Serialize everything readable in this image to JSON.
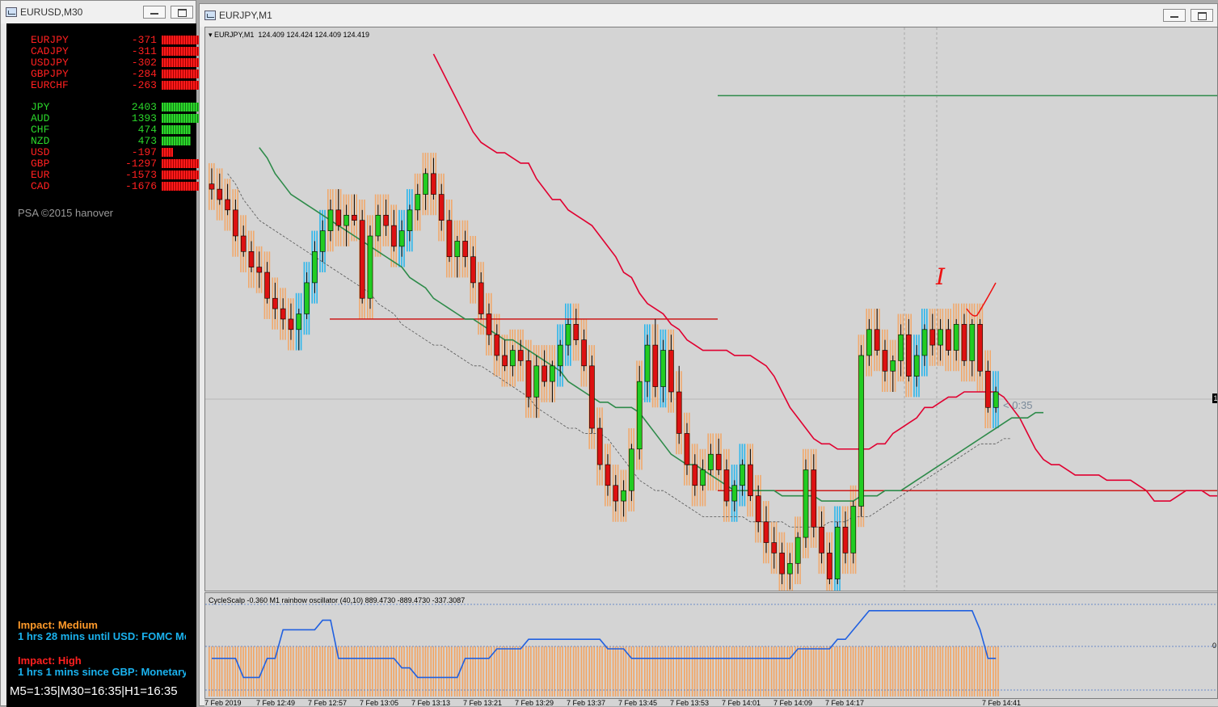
{
  "left_window": {
    "title": "EURUSD,M30",
    "pairs": [
      {
        "name": "EURJPY",
        "value": "-371",
        "color": "#ff2020",
        "bar": 0.95
      },
      {
        "name": "CADJPY",
        "value": "-311",
        "color": "#ff2020",
        "bar": 0.95
      },
      {
        "name": "USDJPY",
        "value": "-302",
        "color": "#ff2020",
        "bar": 0.95
      },
      {
        "name": "GBPJPY",
        "value": "-284",
        "color": "#ff2020",
        "bar": 0.95
      },
      {
        "name": "EURCHF",
        "value": "-263",
        "color": "#ff2020",
        "bar": 0.95
      }
    ],
    "currencies": [
      {
        "name": "JPY",
        "value": "2403",
        "color": "#2bd62b",
        "bar": 0.95
      },
      {
        "name": "AUD",
        "value": "1393",
        "color": "#2bd62b",
        "bar": 0.95
      },
      {
        "name": "CHF",
        "value": "474",
        "color": "#2bd62b",
        "bar": 0.5
      },
      {
        "name": "NZD",
        "value": "473",
        "color": "#2bd62b",
        "bar": 0.5
      },
      {
        "name": "USD",
        "value": "-197",
        "color": "#ff2020",
        "bar": 0.2
      },
      {
        "name": "GBP",
        "value": "-1297",
        "color": "#ff2020",
        "bar": 0.95
      },
      {
        "name": "EUR",
        "value": "-1573",
        "color": "#ff2020",
        "bar": 0.95
      },
      {
        "name": "CAD",
        "value": "-1676",
        "color": "#ff2020",
        "bar": 0.95
      }
    ],
    "copyright": "PSA ©2015 hanover",
    "news": [
      {
        "impact": "Impact: Medium",
        "impact_color": "#ff9a2a",
        "detail": "1 hrs 28 mins until USD: FOMC Me"
      },
      {
        "impact": "Impact: High",
        "impact_color": "#ff2020",
        "detail": "1 hrs 1 mins since GBP: Monetary"
      }
    ],
    "timeframes": "M5=1:35|M30=16:35|H1=16:35"
  },
  "chart_window": {
    "title": "EURJPY,M1",
    "info_symbol": "EURJPY,M1",
    "ohlc": "124.409 124.424 124.409 124.419",
    "countdown": "< 0:35",
    "annotation": "I",
    "indicator_label": "CycleScalp -0.360  M1 rainbow oscillator (40,10) 889.4730 -889.4730 -337.3087",
    "right_axis_label": "1",
    "right_axis_bottom_label": "0",
    "time_labels": [
      "7 Feb 2019",
      "7 Feb 12:49",
      "7 Feb 12:57",
      "7 Feb 13:05",
      "7 Feb 13:13",
      "7 Feb 13:21",
      "7 Feb 13:29",
      "7 Feb 13:37",
      "7 Feb 13:45",
      "7 Feb 13:53",
      "7 Feb 14:01",
      "7 Feb 14:09",
      "7 Feb 14:17",
      "7 Feb 14:41"
    ]
  },
  "colors": {
    "bull": "#22cc22",
    "bear": "#dd1111",
    "orange_block": "#f4a460",
    "blue_block": "#1ab2ee",
    "upper_band": "#e00030",
    "middle_band": "#2e8b4a",
    "level_line": "#cc1a1a",
    "chart_bg": "#d4d4d4"
  },
  "chart_data": {
    "type": "candlestick",
    "candles": [
      [
        124.53,
        124.56,
        124.5,
        124.52
      ],
      [
        124.52,
        124.55,
        124.49,
        124.5
      ],
      [
        124.5,
        124.53,
        124.47,
        124.48
      ],
      [
        124.48,
        124.5,
        124.42,
        124.43
      ],
      [
        124.43,
        124.45,
        124.39,
        124.4
      ],
      [
        124.4,
        124.42,
        124.36,
        124.37
      ],
      [
        124.37,
        124.4,
        124.33,
        124.36
      ],
      [
        124.36,
        124.38,
        124.3,
        124.31
      ],
      [
        124.31,
        124.34,
        124.27,
        124.29
      ],
      [
        124.29,
        124.31,
        124.25,
        124.27
      ],
      [
        124.27,
        124.3,
        124.23,
        124.25
      ],
      [
        124.25,
        124.29,
        124.21,
        124.28
      ],
      [
        124.28,
        124.36,
        124.27,
        124.34
      ],
      [
        124.34,
        124.42,
        124.32,
        124.4
      ],
      [
        124.4,
        124.46,
        124.38,
        124.44
      ],
      [
        124.44,
        124.5,
        124.42,
        124.48
      ],
      [
        124.48,
        124.52,
        124.44,
        124.45
      ],
      [
        124.45,
        124.49,
        124.41,
        124.47
      ],
      [
        124.47,
        124.51,
        124.45,
        124.46
      ],
      [
        124.46,
        124.48,
        124.3,
        124.31
      ],
      [
        124.31,
        124.45,
        124.29,
        124.43
      ],
      [
        124.43,
        124.49,
        124.42,
        124.47
      ],
      [
        124.47,
        124.5,
        124.43,
        124.45
      ],
      [
        124.45,
        124.48,
        124.4,
        124.41
      ],
      [
        124.41,
        124.46,
        124.39,
        124.44
      ],
      [
        124.44,
        124.49,
        124.42,
        124.48
      ],
      [
        124.48,
        124.53,
        124.46,
        124.51
      ],
      [
        124.51,
        124.56,
        124.48,
        124.55
      ],
      [
        124.55,
        124.58,
        124.5,
        124.51
      ],
      [
        124.51,
        124.53,
        124.44,
        124.46
      ],
      [
        124.46,
        124.48,
        124.38,
        124.39
      ],
      [
        124.39,
        124.43,
        124.35,
        124.42
      ],
      [
        124.42,
        124.44,
        124.37,
        124.39
      ],
      [
        124.39,
        124.41,
        124.33,
        124.34
      ],
      [
        124.34,
        124.36,
        124.27,
        124.28
      ],
      [
        124.28,
        124.3,
        124.22,
        124.24
      ],
      [
        124.24,
        124.26,
        124.19,
        124.2
      ],
      [
        124.2,
        124.23,
        124.17,
        124.18
      ],
      [
        124.18,
        124.22,
        124.16,
        124.21
      ],
      [
        124.21,
        124.23,
        124.18,
        124.19
      ],
      [
        124.19,
        124.21,
        124.1,
        124.12
      ],
      [
        124.12,
        124.2,
        124.08,
        124.18
      ],
      [
        124.18,
        124.21,
        124.14,
        124.15
      ],
      [
        124.15,
        124.19,
        124.11,
        124.18
      ],
      [
        124.18,
        124.23,
        124.16,
        124.22
      ],
      [
        124.22,
        124.27,
        124.2,
        124.26
      ],
      [
        124.26,
        124.29,
        124.22,
        124.23
      ],
      [
        124.23,
        124.25,
        124.17,
        124.18
      ],
      [
        124.18,
        124.2,
        124.05,
        124.06
      ],
      [
        124.06,
        124.08,
        123.98,
        123.99
      ],
      [
        123.99,
        124.01,
        123.93,
        123.95
      ],
      [
        123.95,
        123.97,
        123.9,
        123.92
      ],
      [
        123.92,
        123.96,
        123.89,
        123.94
      ],
      [
        123.94,
        124.03,
        123.92,
        124.02
      ],
      [
        124.02,
        124.18,
        124.0,
        124.15
      ],
      [
        124.15,
        124.24,
        124.12,
        124.22
      ],
      [
        124.22,
        124.27,
        124.12,
        124.14
      ],
      [
        124.14,
        124.23,
        124.11,
        124.21
      ],
      [
        124.21,
        124.24,
        124.11,
        124.13
      ],
      [
        124.13,
        124.18,
        124.03,
        124.05
      ],
      [
        124.05,
        124.07,
        123.97,
        123.99
      ],
      [
        123.99,
        124.01,
        123.93,
        123.95
      ],
      [
        123.95,
        124.0,
        123.94,
        123.98
      ],
      [
        123.98,
        124.03,
        123.97,
        124.01
      ],
      [
        124.01,
        124.04,
        123.97,
        123.98
      ],
      [
        123.98,
        124.0,
        123.91,
        123.92
      ],
      [
        123.92,
        123.96,
        123.9,
        123.95
      ],
      [
        123.95,
        124.0,
        123.93,
        123.99
      ],
      [
        123.99,
        124.02,
        123.92,
        123.93
      ],
      [
        123.93,
        123.95,
        123.86,
        123.88
      ],
      [
        123.88,
        123.91,
        123.82,
        123.84
      ],
      [
        123.84,
        123.87,
        123.79,
        123.82
      ],
      [
        123.82,
        123.84,
        123.76,
        123.78
      ],
      [
        123.78,
        123.82,
        123.75,
        123.8
      ],
      [
        123.8,
        123.86,
        123.78,
        123.85
      ],
      [
        123.85,
        124.0,
        123.83,
        123.98
      ],
      [
        123.98,
        124.01,
        123.85,
        123.87
      ],
      [
        123.87,
        123.9,
        123.8,
        123.82
      ],
      [
        123.82,
        123.84,
        123.76,
        123.77
      ],
      [
        123.77,
        123.88,
        123.76,
        123.87
      ],
      [
        123.87,
        123.9,
        123.8,
        123.82
      ],
      [
        123.82,
        123.92,
        123.8,
        123.91
      ],
      [
        123.91,
        124.22,
        123.89,
        124.2
      ],
      [
        124.2,
        124.27,
        124.18,
        124.25
      ],
      [
        124.25,
        124.29,
        124.2,
        124.21
      ],
      [
        124.21,
        124.23,
        124.15,
        124.17
      ],
      [
        124.17,
        124.2,
        124.13,
        124.19
      ],
      [
        124.19,
        124.26,
        124.16,
        124.24
      ],
      [
        124.24,
        124.27,
        124.15,
        124.16
      ],
      [
        124.16,
        124.22,
        124.14,
        124.2
      ],
      [
        124.2,
        124.26,
        124.18,
        124.25
      ],
      [
        124.25,
        124.28,
        124.2,
        124.22
      ],
      [
        124.22,
        124.27,
        124.19,
        124.25
      ],
      [
        124.25,
        124.27,
        124.2,
        124.21
      ],
      [
        124.21,
        124.27,
        124.19,
        124.26
      ],
      [
        124.26,
        124.28,
        124.18,
        124.19
      ],
      [
        124.19,
        124.27,
        124.16,
        124.26
      ],
      [
        124.26,
        124.27,
        124.16,
        124.17
      ],
      [
        124.17,
        124.19,
        124.09,
        124.1
      ],
      [
        124.1,
        124.14,
        124.09,
        124.13
      ]
    ],
    "upper_band": [
      124.78,
      124.75,
      124.72,
      124.69,
      124.66,
      124.63,
      124.61,
      124.6,
      124.59,
      124.59,
      124.58,
      124.57,
      124.57,
      124.54,
      124.52,
      124.5,
      124.5,
      124.48,
      124.47,
      124.46,
      124.45,
      124.43,
      124.41,
      124.39,
      124.36,
      124.35,
      124.32,
      124.3,
      124.29,
      124.28,
      124.26,
      124.25,
      124.23,
      124.22,
      124.21,
      124.21,
      124.21,
      124.21,
      124.2,
      124.2,
      124.2,
      124.19,
      124.18,
      124.16,
      124.13,
      124.1,
      124.08,
      124.06,
      124.04,
      124.03,
      124.03,
      124.02,
      124.02,
      124.02,
      124.02,
      124.02,
      124.03,
      124.03,
      124.05,
      124.06,
      124.07,
      124.08,
      124.1,
      124.1,
      124.11,
      124.12,
      124.12,
      124.13,
      124.13,
      124.13,
      124.13,
      124.13,
      124.12,
      124.1,
      124.08,
      124.05,
      124.02,
      124.0,
      123.99,
      123.99,
      123.98,
      123.97,
      123.97,
      123.97,
      123.97,
      123.96,
      123.96,
      123.96,
      123.96,
      123.95,
      123.94,
      123.92,
      123.92,
      123.92,
      123.93,
      123.94,
      123.94,
      123.94,
      123.93,
      123.93
    ],
    "middle_band": [
      124.6,
      124.58,
      124.55,
      124.53,
      124.51,
      124.5,
      124.49,
      124.48,
      124.47,
      124.46,
      124.45,
      124.44,
      124.43,
      124.42,
      124.41,
      124.4,
      124.39,
      124.38,
      124.37,
      124.35,
      124.34,
      124.33,
      124.31,
      124.3,
      124.29,
      124.28,
      124.27,
      124.27,
      124.26,
      124.25,
      124.24,
      124.23,
      124.23,
      124.22,
      124.21,
      124.2,
      124.19,
      124.18,
      124.17,
      124.15,
      124.14,
      124.13,
      124.12,
      124.11,
      124.11,
      124.1,
      124.1,
      124.1,
      124.09,
      124.07,
      124.05,
      124.03,
      124.01,
      124.0,
      123.99,
      123.99,
      123.98,
      123.97,
      123.96,
      123.95,
      123.94,
      123.94,
      123.94,
      123.94,
      123.94,
      123.94,
      123.93,
      123.93,
      123.93,
      123.93,
      123.93,
      123.92,
      123.92,
      123.92,
      123.92,
      123.92,
      123.93,
      123.93,
      123.93,
      123.94,
      123.94,
      123.94,
      123.95,
      123.96,
      123.97,
      123.98,
      123.99,
      124.0,
      124.01,
      124.02,
      124.03,
      124.04,
      124.05,
      124.06,
      124.07,
      124.08,
      124.08,
      124.08,
      124.09,
      124.09
    ],
    "level_high": 124.27,
    "level_low": 123.94,
    "level_top": 124.7,
    "oscillator": [
      0.4,
      0.4,
      0.4,
      0.4,
      0.2,
      0.2,
      0.2,
      0.4,
      0.4,
      0.7,
      0.7,
      0.7,
      0.7,
      0.7,
      0.8,
      0.8,
      0.4,
      0.4,
      0.4,
      0.4,
      0.4,
      0.4,
      0.4,
      0.4,
      0.3,
      0.3,
      0.2,
      0.2,
      0.2,
      0.2,
      0.2,
      0.2,
      0.4,
      0.4,
      0.4,
      0.4,
      0.5,
      0.5,
      0.5,
      0.5,
      0.6,
      0.6,
      0.6,
      0.6,
      0.6,
      0.6,
      0.6,
      0.6,
      0.6,
      0.6,
      0.5,
      0.5,
      0.5,
      0.4,
      0.4,
      0.4,
      0.4,
      0.4,
      0.4,
      0.4,
      0.4,
      0.4,
      0.4,
      0.4,
      0.4,
      0.4,
      0.4,
      0.4,
      0.4,
      0.4,
      0.4,
      0.4,
      0.4,
      0.4,
      0.5,
      0.5,
      0.5,
      0.5,
      0.5,
      0.6,
      0.6,
      0.7,
      0.8,
      0.9,
      0.9,
      0.9,
      0.9,
      0.9,
      0.9,
      0.9,
      0.9,
      0.9,
      0.9,
      0.9,
      0.9,
      0.9,
      0.9,
      0.7,
      0.4,
      0.4
    ],
    "ylim": [
      123.76,
      124.8
    ]
  }
}
